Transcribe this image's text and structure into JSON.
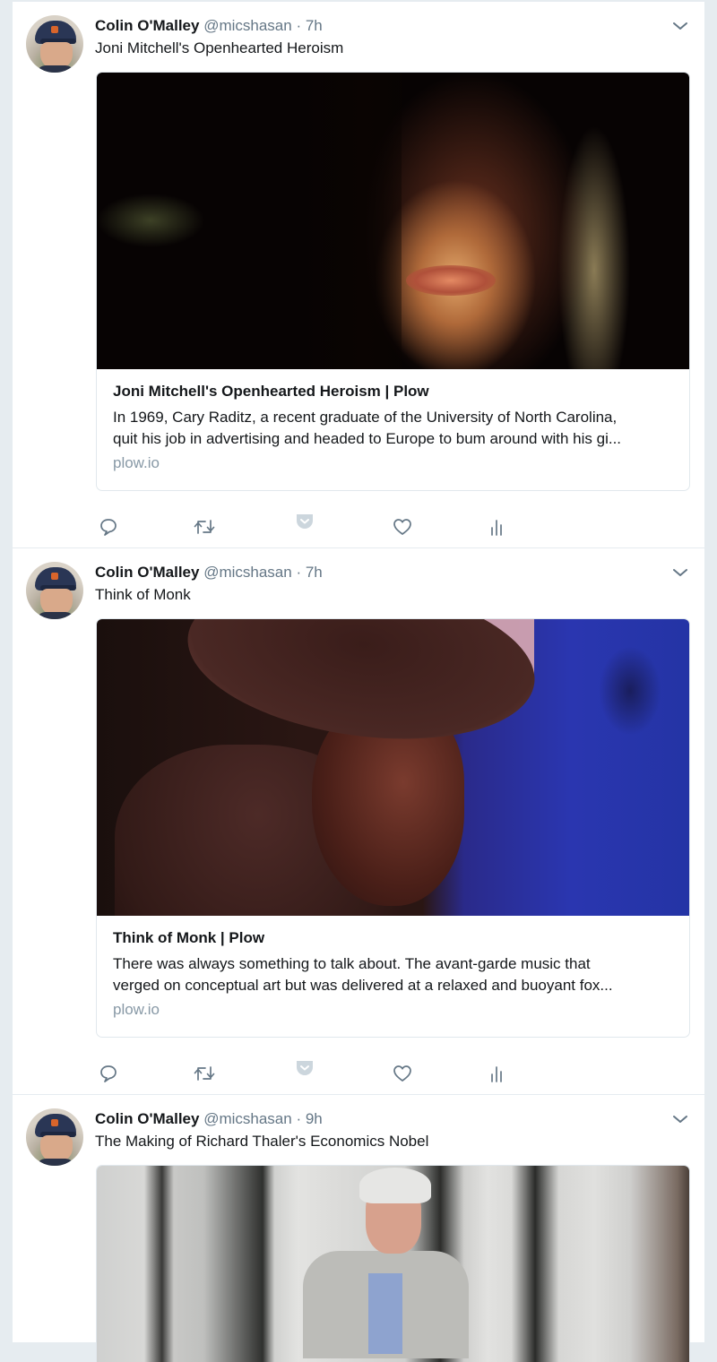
{
  "colors": {
    "background": "#e6ecf0",
    "text_primary": "#14171a",
    "text_secondary": "#657786",
    "domain_text": "#8899a6",
    "border": "#e1e8ed",
    "icon": "#657786",
    "pocket_icon": "#ccd6dd"
  },
  "tweets": [
    {
      "author_name": "Colin O'Malley",
      "handle": "@micshasan",
      "separator": "·",
      "time": "7h",
      "text": "Joni Mitchell's Openhearted Heroism",
      "card": {
        "image_alt": "Close-up portrait of Joni Mitchell in dim warm light",
        "title": "Joni Mitchell's Openhearted Heroism | Plow",
        "description_line1": "In 1969, Cary Raditz, a recent graduate of the University of North Carolina,",
        "description_line2": "quit his job in advertising and headed to Europe to bum around with his gi...",
        "domain": "plow.io"
      },
      "actions": [
        "reply-icon",
        "retweet-icon",
        "pocket-icon",
        "like-icon",
        "analytics-icon"
      ]
    },
    {
      "author_name": "Colin O'Malley",
      "handle": "@micshasan",
      "separator": "·",
      "time": "7h",
      "text": "Think of Monk",
      "card": {
        "image_alt": "Profile of Thelonious Monk in a hat against a blue background",
        "title": "Think of Monk | Plow",
        "description_line1": "There was always something to talk about. The avant-garde music that",
        "description_line2": "verged on conceptual art but was delivered at a relaxed and buoyant fox...",
        "domain": "plow.io"
      },
      "actions": [
        "reply-icon",
        "retweet-icon",
        "pocket-icon",
        "like-icon",
        "analytics-icon"
      ]
    },
    {
      "author_name": "Colin O'Malley",
      "handle": "@micshasan",
      "separator": "·",
      "time": "9h",
      "text": "The Making of Richard Thaler's Economics Nobel",
      "card": {
        "image_alt": "Richard Thaler seated in front of a columned building"
      }
    }
  ]
}
